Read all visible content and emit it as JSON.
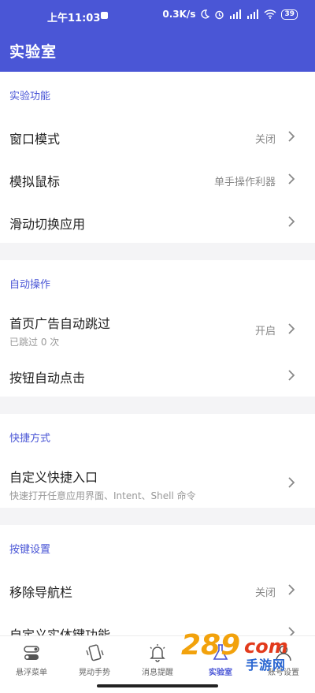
{
  "status_bar": {
    "time": "上午11:03",
    "net_speed": "0.3K/s",
    "battery": "39"
  },
  "app_bar": {
    "title": "实验室"
  },
  "sections": [
    {
      "header": "实验功能",
      "rows": [
        {
          "title": "窗口模式",
          "value": "关闭"
        },
        {
          "title": "模拟鼠标",
          "value": "单手操作利器"
        },
        {
          "title": "滑动切换应用",
          "value": ""
        }
      ]
    },
    {
      "header": "自动操作",
      "rows": [
        {
          "title": "首页广告自动跳过",
          "subtitle": "已跳过 0 次",
          "value": "开启"
        },
        {
          "title": "按钮自动点击",
          "value": ""
        }
      ]
    },
    {
      "header": "快捷方式",
      "rows": [
        {
          "title": "自定义快捷入口",
          "subtitle": "快速打开任意应用界面、Intent、Shell 命令",
          "value": ""
        }
      ]
    },
    {
      "header": "按键设置",
      "rows": [
        {
          "title": "移除导航栏",
          "value": "关闭"
        },
        {
          "title": "自定义实体键功能",
          "value": ""
        }
      ]
    }
  ],
  "bottom_nav": {
    "items": [
      {
        "label": "悬浮菜单",
        "icon": "toggle-icon"
      },
      {
        "label": "晃动手势",
        "icon": "shake-phone-icon"
      },
      {
        "label": "消息提醒",
        "icon": "bell-icon"
      },
      {
        "label": "实验室",
        "icon": "lab-icon",
        "active": true
      },
      {
        "label": "账号设置",
        "icon": "account-icon"
      }
    ]
  },
  "watermark": {
    "num": "289",
    "com": "com",
    "sub": "手游网"
  },
  "colors": {
    "primary": "#4a56d6",
    "section_header": "#4a56d6",
    "background": "#f4f4f6",
    "watermark_orange": "#f2a20c"
  }
}
